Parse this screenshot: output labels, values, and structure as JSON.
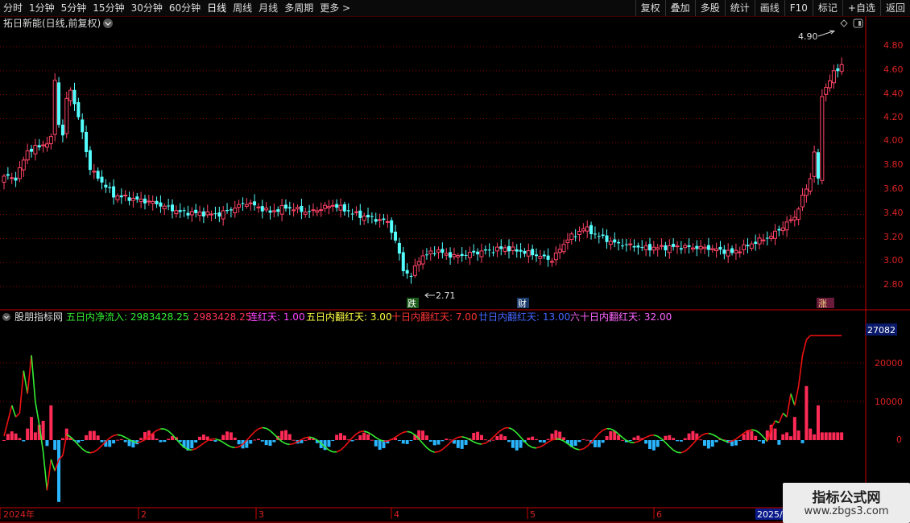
{
  "toolbar": {
    "periods": [
      "分时",
      "1分钟",
      "5分钟",
      "15分钟",
      "30分钟",
      "60分钟",
      "日线",
      "周线",
      "月线",
      "多周期",
      "更多"
    ],
    "active_period": "日线",
    "more_icon": "chevron-right-icon",
    "actions": [
      "复权",
      "叠加",
      "多股",
      "统计",
      "画线",
      "F10",
      "标记",
      "+自选",
      "返回"
    ]
  },
  "stock": {
    "title": "拓日新能(日线,前复权)",
    "title_icon": "chevron-down-icon",
    "high_label": "4.90",
    "low_label": "2.71",
    "price_ticks": [
      "4.80",
      "4.60",
      "4.40",
      "4.20",
      "4.00",
      "3.80",
      "3.60",
      "3.40",
      "3.20",
      "3.00",
      "2.80"
    ]
  },
  "markers": {
    "fall": "跌",
    "finance": "财",
    "rise": "涨"
  },
  "indicator": {
    "name": "股朋指标网",
    "items": [
      {
        "label": "五日内净流入: 2983428.25",
        "color": "#33ee33"
      },
      {
        "label": ": 2983428.25",
        "color": "#ff3355"
      },
      {
        "label": "连红天: 1.00",
        "color": "#ff44ff"
      },
      {
        "label": "五日内翻红天: 3.00",
        "color": "#ffff44"
      },
      {
        "label": "十日内翻红天: 7.00",
        "color": "#ff3333"
      },
      {
        "label": "廿日内翻红天: 13.00",
        "color": "#4466ff"
      },
      {
        "label": "六十日内翻红天: 32.00",
        "color": "#ff66ff"
      }
    ],
    "current_value": "27082",
    "ticks": [
      "20000",
      "10000",
      "0"
    ]
  },
  "dates": {
    "labels": [
      "2024年",
      "2",
      "3",
      "4",
      "5",
      "6",
      "2025/"
    ]
  },
  "watermark": {
    "title": "指标公式网",
    "url": "www.zbgs3.com"
  },
  "colors": {
    "up": "#ff4466",
    "down": "#54ffff",
    "grid": "#8b0000",
    "axis": "#cc0000",
    "net_line_up": "#ee1111",
    "net_line_down": "#33ee33"
  }
}
